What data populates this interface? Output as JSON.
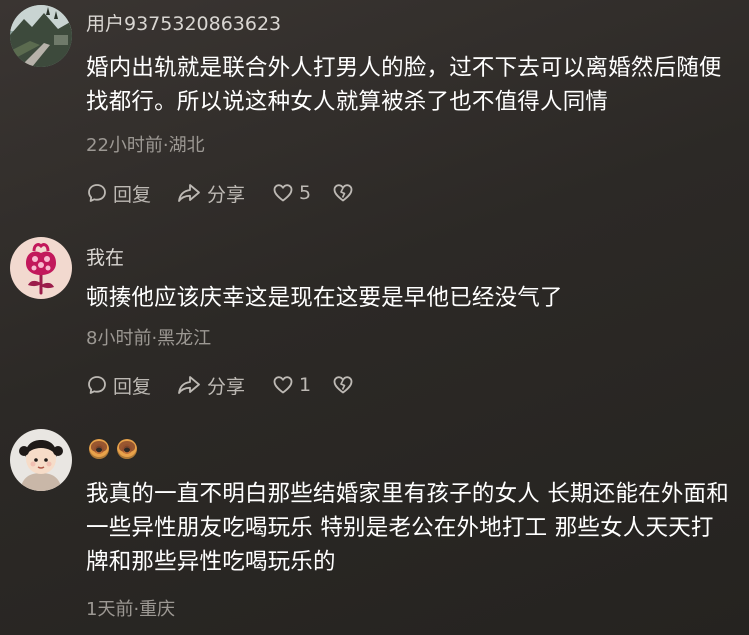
{
  "comments": [
    {
      "username": "用户9375320863623",
      "text": "婚内出轨就是联合外人打男人的脸，过不下去可以离婚然后随便找都行。所以说这种女人就算被杀了也不值得人同情",
      "meta": "22小时前·湖北",
      "reply_label": "回复",
      "share_label": "分享",
      "likes": "5",
      "avatar_icon": "landscape-photo"
    },
    {
      "username": "我在",
      "text": "顿揍他应该庆幸这是现在这要是早他已经没气了",
      "meta": "8小时前·黑龙江",
      "reply_label": "回复",
      "share_label": "分享",
      "likes": "1",
      "avatar_icon": "flower-illustration"
    },
    {
      "username_icons": [
        "donut-emoji",
        "donut-emoji"
      ],
      "text": "我真的一直不明白那些结婚家里有孩子的女人 长期还能在外面和一些异性朋友吃喝玩乐 特别是老公在外地打工 那些女人天天打牌和那些异性吃喝玩乐的",
      "meta": "1天前·重庆",
      "avatar_icon": "child-photo"
    }
  ]
}
